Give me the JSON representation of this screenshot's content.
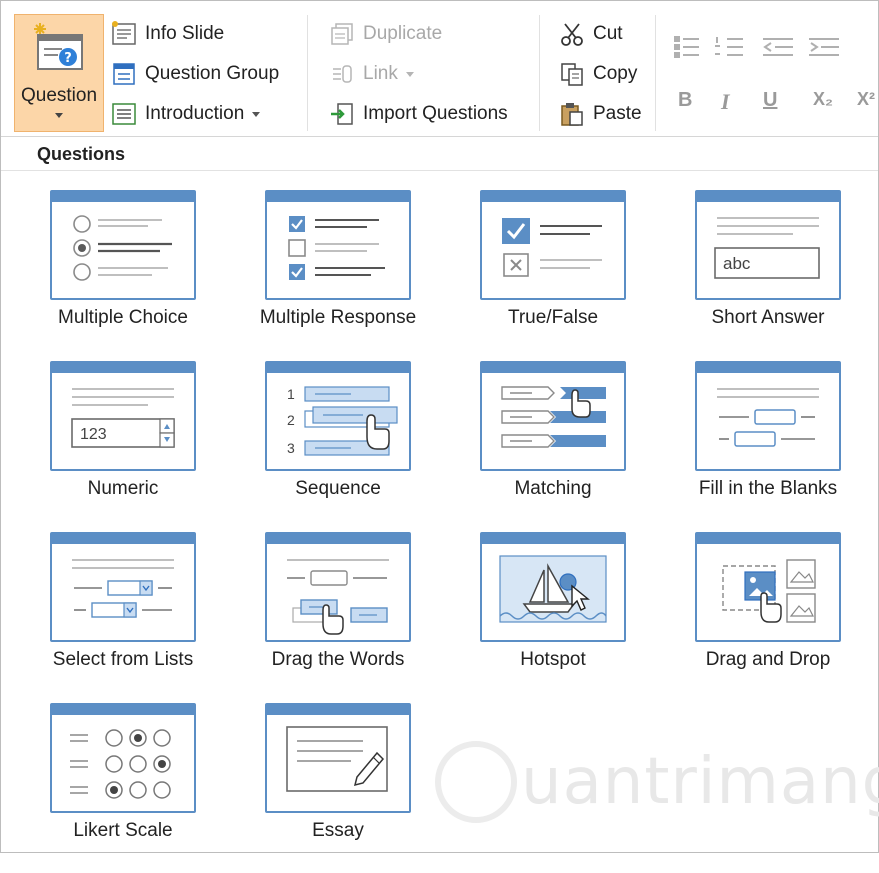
{
  "ribbon": {
    "question": {
      "label": "Question",
      "icon": "question-slide-icon"
    },
    "info_slide": "Info Slide",
    "question_group": "Question Group",
    "introduction": "Introduction",
    "duplicate": "Duplicate",
    "link": "Link",
    "import_questions": "Import Questions",
    "cut": "Cut",
    "copy": "Copy",
    "paste": "Paste",
    "format": {
      "bold": "B",
      "italic": "I",
      "underline": "U",
      "subscript": "X₂",
      "superscript": "X²"
    }
  },
  "gallery": {
    "title": "Questions",
    "items": [
      {
        "label": "Multiple Choice",
        "icon": "multiple-choice-icon"
      },
      {
        "label": "Multiple Response",
        "icon": "multiple-response-icon"
      },
      {
        "label": "True/False",
        "icon": "true-false-icon"
      },
      {
        "label": "Short Answer",
        "icon": "short-answer-icon",
        "sample": "abc"
      },
      {
        "label": "Numeric",
        "icon": "numeric-icon",
        "sample": "123"
      },
      {
        "label": "Sequence",
        "icon": "sequence-icon",
        "steps": [
          "1",
          "2",
          "3"
        ]
      },
      {
        "label": "Matching",
        "icon": "matching-icon"
      },
      {
        "label": "Fill in the Blanks",
        "icon": "fill-blanks-icon"
      },
      {
        "label": "Select from Lists",
        "icon": "select-lists-icon"
      },
      {
        "label": "Drag the Words",
        "icon": "drag-words-icon"
      },
      {
        "label": "Hotspot",
        "icon": "hotspot-icon"
      },
      {
        "label": "Drag and Drop",
        "icon": "drag-drop-icon"
      },
      {
        "label": "Likert Scale",
        "icon": "likert-scale-icon"
      },
      {
        "label": "Essay",
        "icon": "essay-icon"
      }
    ]
  },
  "watermark": "uantrimang",
  "colors": {
    "accent": "#5b8ec5",
    "selected_bg": "#fcd6a8",
    "fill_light": "#c8dcf2"
  }
}
